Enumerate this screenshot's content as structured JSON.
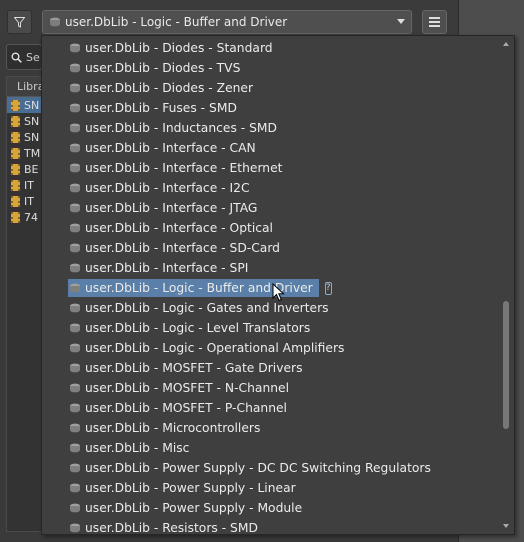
{
  "header": {
    "selected_library": "user.DbLib - Logic - Buffer and Driver",
    "search_placeholder": "Se"
  },
  "left_panel": {
    "header": "Libra",
    "rows": [
      {
        "label": "SN",
        "selected": true
      },
      {
        "label": "SN",
        "selected": false
      },
      {
        "label": "SN",
        "selected": false
      },
      {
        "label": "TM",
        "selected": false
      },
      {
        "label": "BE",
        "selected": false
      },
      {
        "label": "IT",
        "selected": false
      },
      {
        "label": "IT",
        "selected": false
      },
      {
        "label": "74",
        "selected": false
      }
    ]
  },
  "dropdown": {
    "items": [
      "user.DbLib - Diodes - Standard",
      "user.DbLib - Diodes - TVS",
      "user.DbLib - Diodes - Zener",
      "user.DbLib - Fuses - SMD",
      "user.DbLib - Inductances - SMD",
      "user.DbLib - Interface - CAN",
      "user.DbLib - Interface - Ethernet",
      "user.DbLib - Interface - I2C",
      "user.DbLib - Interface - JTAG",
      "user.DbLib - Interface - Optical",
      "user.DbLib - Interface - SD-Card",
      "user.DbLib - Interface - SPI",
      "user.DbLib - Logic - Buffer and Driver",
      "user.DbLib - Logic - Gates and Inverters",
      "user.DbLib - Logic - Level Translators",
      "user.DbLib - Logic - Operational Amplifiers",
      "user.DbLib - MOSFET - Gate Drivers",
      "user.DbLib - MOSFET - N-Channel",
      "user.DbLib - MOSFET - P-Channel",
      "user.DbLib - Microcontrollers",
      "user.DbLib - Misc",
      "user.DbLib - Power Supply - DC DC Switching Regulators",
      "user.DbLib - Power Supply - Linear",
      "user.DbLib - Power Supply - Module",
      "user.DbLib - Resistors - SMD"
    ],
    "selected_index": 12,
    "info_badge": "?",
    "scroll_position": 0.73,
    "scroll_visible_fraction": 0.27
  },
  "icons": {
    "filter": "filter-icon",
    "menu": "hamburger-menu-icon",
    "search": "search-icon",
    "library": "database-library-icon",
    "component": "component-chip-icon"
  },
  "colors": {
    "selection": "#5a7fa8",
    "background": "#3f3f3f",
    "text": "#ececec"
  }
}
